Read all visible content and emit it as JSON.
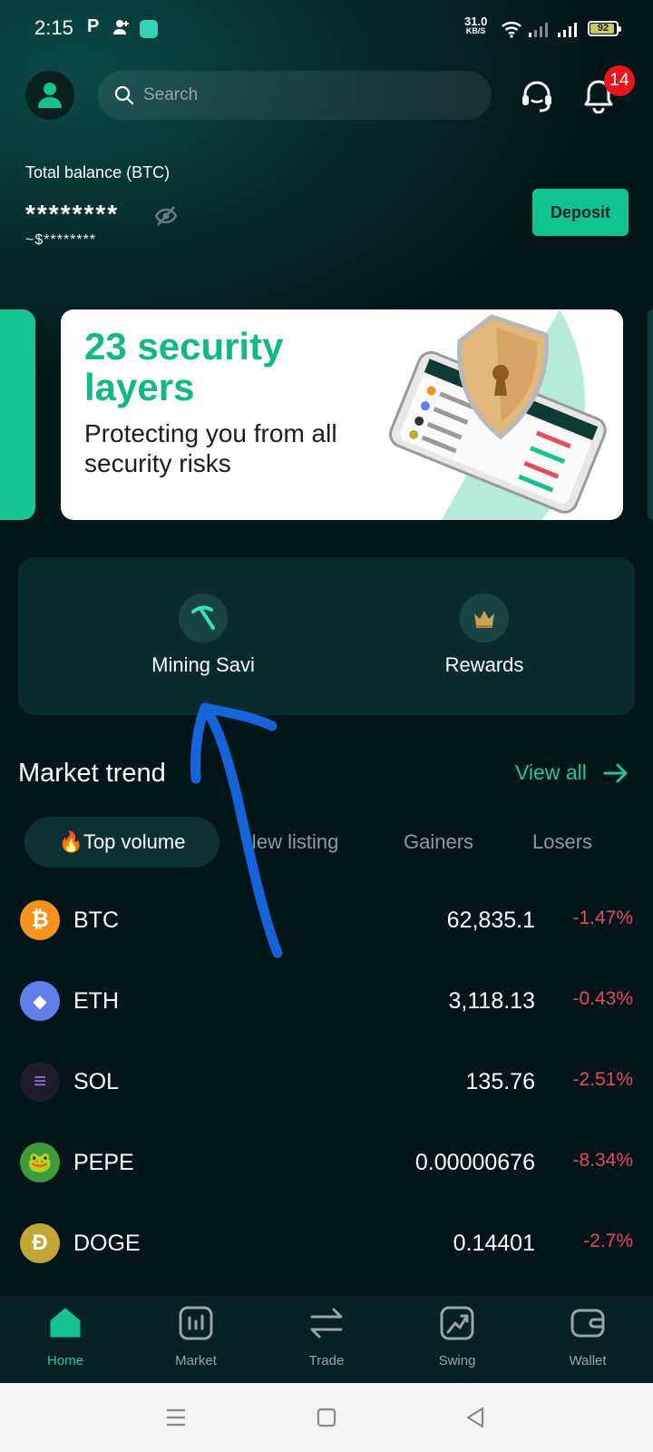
{
  "status_bar": {
    "time": "2:15",
    "p_icon": "P",
    "net_speed": "31.0",
    "net_unit": "KB/S",
    "battery": "92"
  },
  "header": {
    "search_placeholder": "Search",
    "notification_count": "14"
  },
  "balance": {
    "label": "Total balance (BTC)",
    "value": "********",
    "usd": "~$********",
    "deposit_label": "Deposit"
  },
  "banner": {
    "title": "23 security layers",
    "subtitle": "Protecting you from all security risks"
  },
  "quick_actions": [
    {
      "label": "Mining Savi",
      "icon": "pickaxe-icon"
    },
    {
      "label": "Rewards",
      "icon": "crown-icon"
    }
  ],
  "market": {
    "title": "Market trend",
    "view_all": "View all",
    "tabs": [
      "Top volume",
      "New listing",
      "Gainers",
      "Losers"
    ],
    "active_tab_emoji": "🔥",
    "coins": [
      {
        "symbol": "BTC",
        "price": "62,835.1",
        "change": "-1.47%",
        "color": "#f7931a",
        "glyph": "₿"
      },
      {
        "symbol": "ETH",
        "price": "3,118.13",
        "change": "-0.43%",
        "color": "#627eea",
        "glyph": "◆"
      },
      {
        "symbol": "SOL",
        "price": "135.76",
        "change": "-2.51%",
        "color": "#1c1c2a",
        "glyph": "≡"
      },
      {
        "symbol": "PEPE",
        "price": "0.00000676",
        "change": "-8.34%",
        "color": "#3d9b3a",
        "glyph": "🐸"
      },
      {
        "symbol": "DOGE",
        "price": "0.14401",
        "change": "-2.7%",
        "color": "#c3a634",
        "glyph": "Ð"
      }
    ]
  },
  "bottom_nav": [
    {
      "label": "Home",
      "icon": "home-icon",
      "active": true
    },
    {
      "label": "Market",
      "icon": "market-icon",
      "active": false
    },
    {
      "label": "Trade",
      "icon": "trade-icon",
      "active": false
    },
    {
      "label": "Swing",
      "icon": "swing-icon",
      "active": false
    },
    {
      "label": "Wallet",
      "icon": "wallet-icon",
      "active": false
    }
  ],
  "colors": {
    "accent": "#12c391",
    "negative": "#f0435c",
    "background": "#031719",
    "annotation_arrow": "#1565d8"
  }
}
